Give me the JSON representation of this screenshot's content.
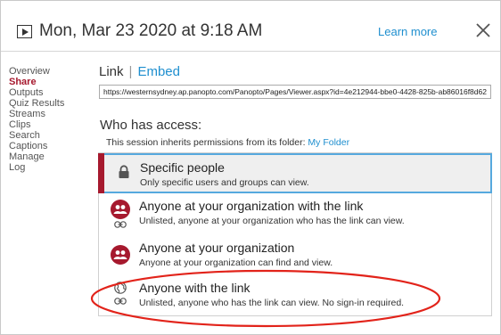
{
  "header": {
    "title": "Mon, Mar 23 2020 at 9:18 AM",
    "learn_more": "Learn more"
  },
  "sidebar": {
    "items": [
      {
        "label": "Overview"
      },
      {
        "label": "Share"
      },
      {
        "label": "Outputs"
      },
      {
        "label": "Quiz Results"
      },
      {
        "label": "Streams"
      },
      {
        "label": "Clips"
      },
      {
        "label": "Search"
      },
      {
        "label": "Captions"
      },
      {
        "label": "Manage"
      },
      {
        "label": "Log"
      }
    ],
    "active": "Share"
  },
  "share": {
    "tab_link": "Link",
    "tab_separator": "|",
    "tab_embed": "Embed",
    "url": "https://westernsydney.ap.panopto.com/Panopto/Pages/Viewer.aspx?id=4e212944-bbe0-4428-825b-ab86016f8d62",
    "who_has_access": "Who has access:",
    "inherit_text": "This session inherits permissions from its folder:",
    "folder_name": "My Folder",
    "options": [
      {
        "title": "Specific people",
        "desc": "Only specific users and groups can view."
      },
      {
        "title": "Anyone at your organization with the link",
        "desc": "Unlisted, anyone at your organization who has the link can view."
      },
      {
        "title": "Anyone at your organization",
        "desc": "Anyone at your organization can find and view."
      },
      {
        "title": "Anyone with the link",
        "desc": "Unlisted, anyone who has the link can view. No sign-in required."
      }
    ],
    "selected_option": "Specific people"
  },
  "colors": {
    "accent_red": "#a6192e",
    "link_blue": "#1f8fcf",
    "selected_border": "#56a9de",
    "annotation_red": "#e2231a"
  }
}
